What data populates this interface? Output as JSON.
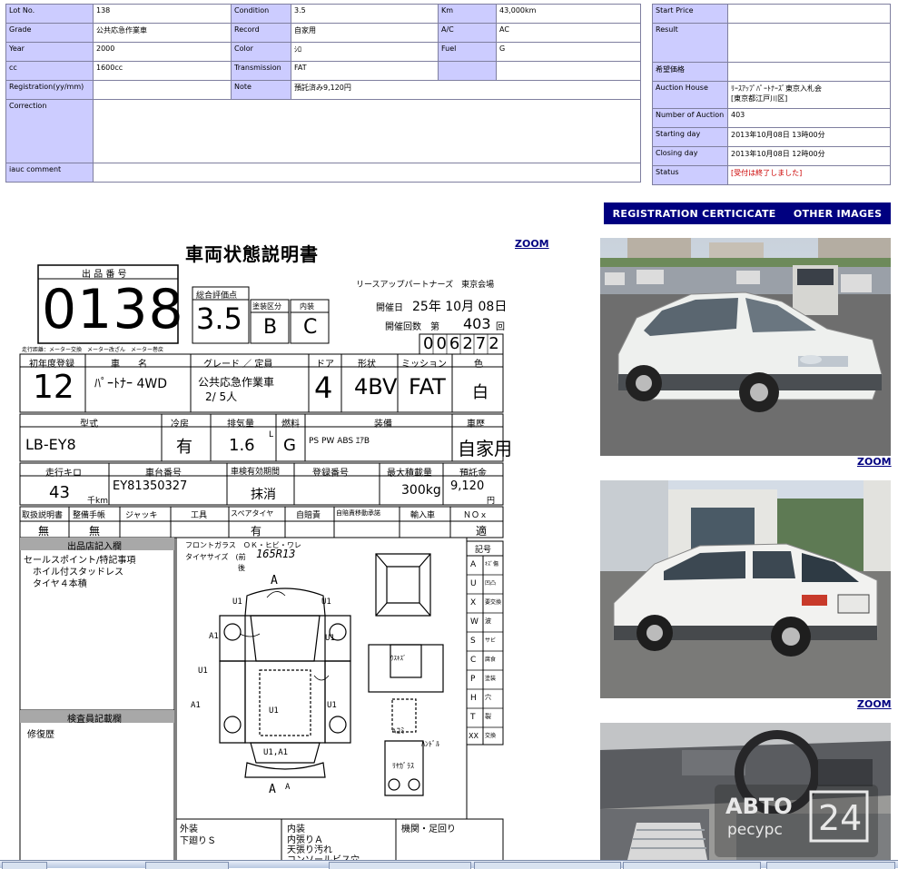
{
  "main": {
    "lot_no_label": "Lot No.",
    "lot_no": "138",
    "condition_label": "Condition",
    "condition": "3.5",
    "km_label": "Km",
    "km": "43,000km",
    "grade_label": "Grade",
    "grade": "公共応急作業車",
    "record_label": "Record",
    "record": "自家用",
    "ac_label": "A/C",
    "ac": "AC",
    "year_label": "Year",
    "year": "2000",
    "color_label": "Color",
    "color": "ｼﾛ",
    "fuel_label": "Fuel",
    "fuel": "G",
    "cc_label": "cc",
    "cc": "1600cc",
    "transmission_label": "Transmission",
    "transmission": "FAT",
    "registration_label": "Registration(yy/mm)",
    "registration": "",
    "note_label": "Note",
    "note": "預託済み9,120円",
    "correction_label": "Correction",
    "correction": "",
    "iauc_label": "iauc comment",
    "iauc": ""
  },
  "side": {
    "start_price_label": "Start Price",
    "start_price": "",
    "result_label": "Result",
    "result": "",
    "desired_label": "希望価格",
    "desired": "",
    "house_label": "Auction House",
    "house": "ﾘｰｽｱｯﾌﾟﾊﾟｰﾄﾅｰｽﾞ東京入札会\n[東京都江戸川区]",
    "number_label": "Number of Auction",
    "number": "403",
    "start_label": "Starting day",
    "start": "2013年10月08日 13時00分",
    "close_label": "Closing day",
    "close": "2013年10月08日 12時00分",
    "status_label": "Status",
    "status": "[受付は終了しました]"
  },
  "tabs": {
    "registration": "REGISTRATION CERTICICATE",
    "other": "OTHER IMAGES"
  },
  "zoom": "ZOOM",
  "watermark": {
    "line1": "АВТО",
    "line2": "ресурс",
    "num": "24"
  },
  "sheet": {
    "title": "車両状態説明書",
    "lot_header": "出 品 番 号",
    "lot_number": "0138",
    "score_header": "総合評価点",
    "score": "3.5",
    "paint_header": "塗装区分",
    "paint": "B",
    "interior_header": "内装",
    "interior": "C",
    "company": "リースアップパートナーズ　東京会場",
    "date_label": "開催日",
    "date_value": "25年 10月 08日",
    "count_label": "開催回数　第",
    "count_value": "403",
    "count_suffix": "回",
    "serial": "006272",
    "note_line": "走行距離：メーター交換　メーター改ざん　メーター巻戻",
    "h_first_reg": "初年度登録",
    "first_reg": "12",
    "h_car": "車　　名",
    "car": "ﾊﾟｰﾄﾅｰ 4WD",
    "h_grade": "グレード ／ 定員",
    "grade": "公共応急作業車",
    "capacity": "2/ 5人",
    "h_door": "ドア",
    "door": "4",
    "h_shape": "形状",
    "shape": "4BV",
    "h_mission": "ミッション",
    "mission": "FAT",
    "h_color": "色",
    "color": "白",
    "h_model": "型式",
    "model": "LB-EY8",
    "h_cool": "冷房",
    "cool": "有",
    "h_disp": "排気量",
    "disp": "1.6",
    "disp_unit": "L",
    "h_fuel": "燃料",
    "fuel": "G",
    "h_equip": "装備",
    "equip": "PS PW ABS ｴｱB",
    "h_history": "車歴",
    "history": "自家用",
    "h_mileage": "走行キロ",
    "mileage": "43",
    "mileage_unit": "千km",
    "h_chassis": "車台番号",
    "chassis": "EY81350327",
    "h_inspect": "車検有効期間",
    "inspect": "抹消",
    "h_regno": "登録番号",
    "regno": "",
    "h_load": "最大積載量",
    "load": "300kg",
    "h_deposit": "預託金",
    "deposit": "9,120",
    "deposit_unit": "円",
    "h_manual": "取扱説明書",
    "manual": "無",
    "h_service": "整備手帳",
    "service": "無",
    "h_jack": "ジャッキ",
    "jack": "",
    "h_tools": "工具",
    "tools": "",
    "h_spare": "スペアタイヤ",
    "spare": "有",
    "h_insurance": "自賠責",
    "insurance": "",
    "h_recycle": "自賠責移動承諾",
    "recycle": "",
    "h_import": "輸入車",
    "import": "",
    "h_nox": "ＮＯｘ",
    "nox": "適",
    "seller_header": "出品店記入欄",
    "seller_lines": [
      "セールスポイント/特記事項",
      "ホイル付スタッドレス",
      "タイヤ４本積"
    ],
    "inspector_header": "検査員記載欄",
    "inspector_note": "修復歴",
    "diag_glass": "フロントガラス　ＯＫ・ヒビ・ワレ",
    "diag_tire": "タイヤサイズ　(前",
    "diag_tire_value": "165R13",
    "diag_tire_rear": "後",
    "legend_header": "記号",
    "legend": [
      {
        "k": "A",
        "v": "ｷｽﾞ傷"
      },
      {
        "k": "U",
        "v": "凹凸"
      },
      {
        "k": "X",
        "v": "要交換"
      },
      {
        "k": "W",
        "v": "波"
      },
      {
        "k": "S",
        "v": "サビ"
      },
      {
        "k": "C",
        "v": "腐食"
      },
      {
        "k": "P",
        "v": "塗装"
      },
      {
        "k": "H",
        "v": "穴"
      },
      {
        "k": "T",
        "v": "裂"
      },
      {
        "k": "XX",
        "v": "交換"
      }
    ],
    "ext_header": "外装",
    "ext_text": "下廻りＳ",
    "int_header": "内装",
    "int_lines": [
      "内張りＡ",
      "天張り汚れ",
      "コンソールビス穴"
    ],
    "mech_header": "機関・足回り",
    "marks": [
      "A",
      "A",
      "U1",
      "U1",
      "A1",
      "U1",
      "A1",
      "U1",
      "U1",
      "U1",
      "U1,A1",
      "A",
      "ﾍｺﾐ",
      "ﾊﾝﾄﾞﾙ",
      "ﾘﾔｶﾞﾗｽ",
      "ｳｽｷｽﾞ"
    ]
  }
}
